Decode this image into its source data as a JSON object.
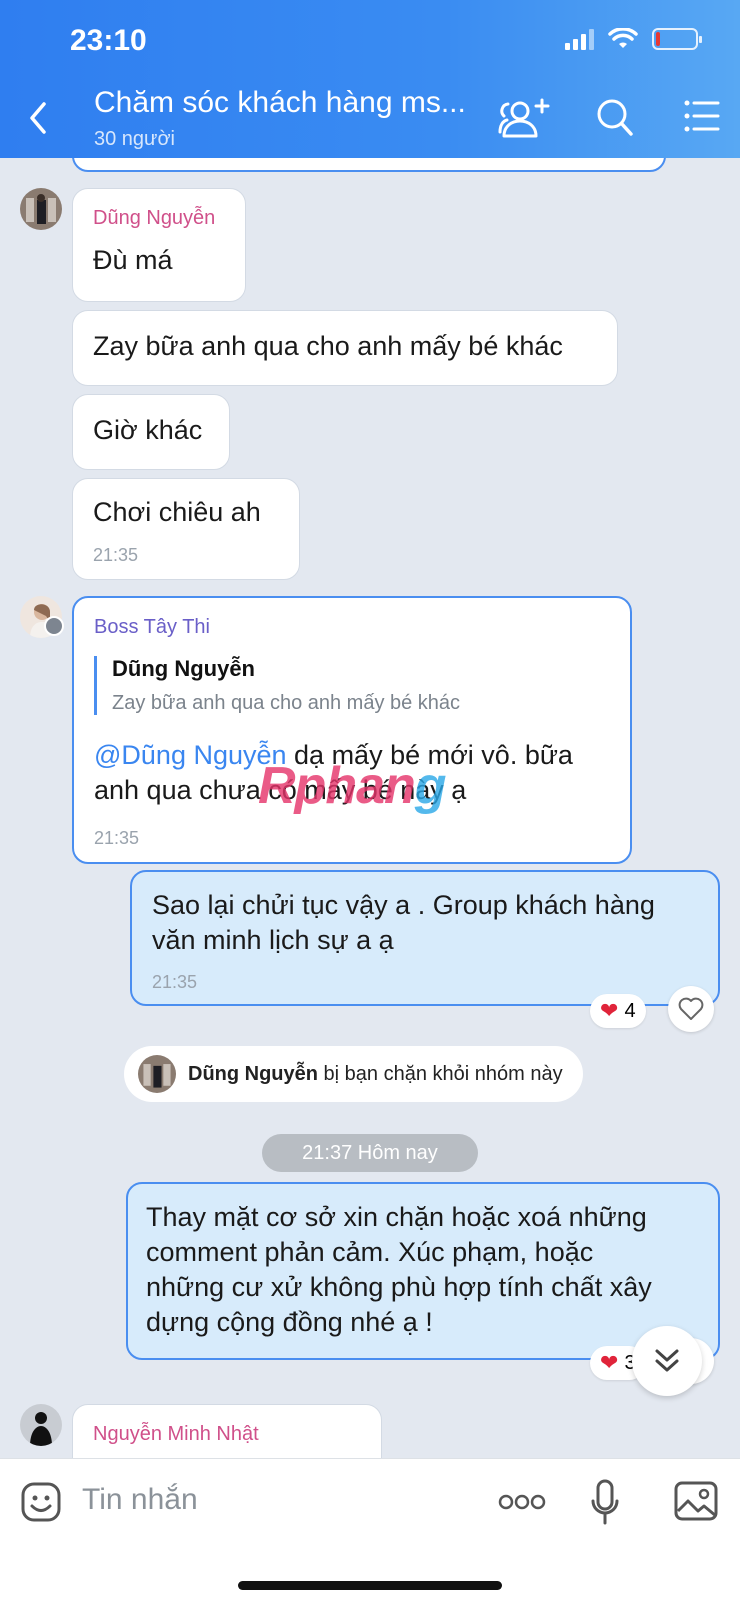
{
  "status": {
    "time": "23:10"
  },
  "header": {
    "title": "Chăm sóc khách hàng ms...",
    "subtitle": "30 người"
  },
  "messages": {
    "m1": {
      "sender": "Dũng Nguyễn",
      "text": "Đù má"
    },
    "m2": {
      "text": "Zay bữa anh qua cho anh mấy bé khác"
    },
    "m3": {
      "text": "Giờ khác"
    },
    "m4": {
      "text": "Chơi chiêu ah",
      "time": "21:35"
    },
    "m5": {
      "sender": "Boss Tây Thi",
      "quote_name": "Dũng Nguyễn",
      "quote_text": "Zay bữa anh qua cho anh mấy bé khác",
      "mention": "@Dũng Nguyễn",
      "text_line1_rest": " dạ mấy bé mới vô. bữa",
      "text_line2": "anh qua chưa có mấy bé này ạ",
      "time": "21:35"
    },
    "m6": {
      "line1": "Sao lại chửi tục vậy a . Group khách hàng",
      "line2": "văn minh lịch sự a ạ",
      "time": "21:35",
      "reaction_count": "4"
    },
    "system": {
      "name": "Dũng Nguyễn",
      "text": " bị bạn chặn khỏi nhóm này"
    },
    "time_divider": "21:37 Hôm nay",
    "m7": {
      "line1": "Thay mặt cơ sở xin chặn hoặc xoá những",
      "line2": "comment phản cảm. Xúc phạm, hoặc",
      "line3": "những cư xử không phù hợp tính chất xây",
      "line4": "dựng cộng đồng nhé ạ !",
      "reaction_count": "3"
    },
    "m8": {
      "sender": "Nguyễn Minh Nhật"
    }
  },
  "watermark": {
    "part1": "Rphan",
    "part2": "g"
  },
  "input": {
    "placeholder": "Tin nhắn"
  },
  "colors": {
    "accent": "#3a86f0",
    "sender_pink": "#d0508a",
    "sender_purple": "#6a5fc8",
    "heart": "#e0243a"
  }
}
